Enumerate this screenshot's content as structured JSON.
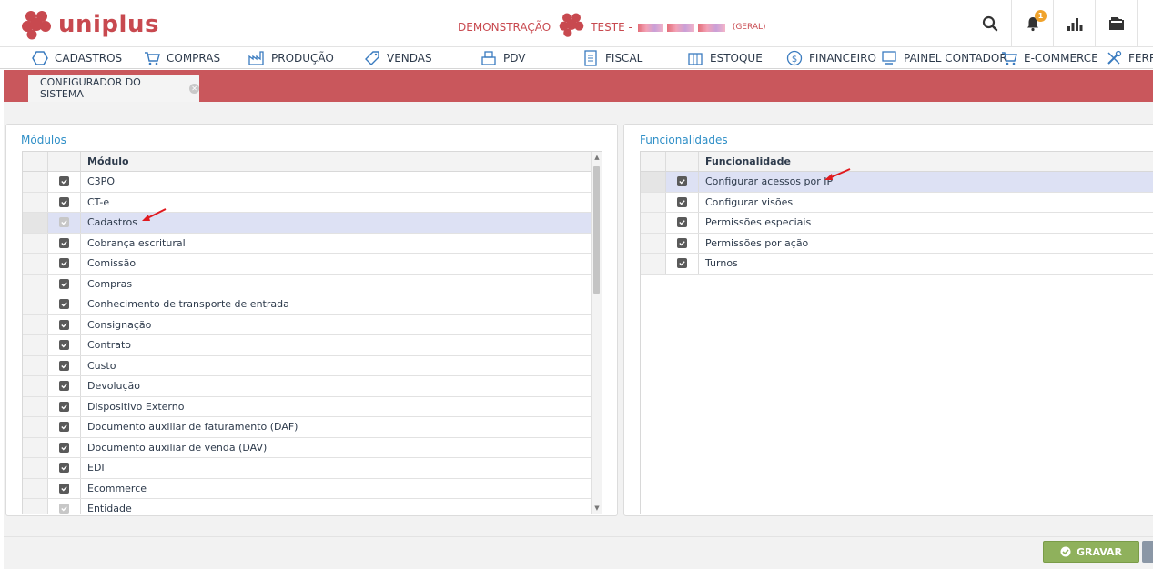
{
  "header": {
    "logo_text": "uniplus",
    "environment_label": "DEMONSTRAÇÃO",
    "company_label": "TESTE -",
    "branch_label": "(GERAL)",
    "notification_count": "1",
    "brand_color": "#c8494f"
  },
  "menu": {
    "items": [
      {
        "label": "CADASTROS",
        "icon": "hexagon-icon"
      },
      {
        "label": "COMPRAS",
        "icon": "cart-icon"
      },
      {
        "label": "PRODUÇÃO",
        "icon": "factory-icon"
      },
      {
        "label": "VENDAS",
        "icon": "tag-icon"
      },
      {
        "label": "PDV",
        "icon": "cash-register-icon"
      },
      {
        "label": "FISCAL",
        "icon": "document-icon"
      },
      {
        "label": "ESTOQUE",
        "icon": "box-icon"
      },
      {
        "label": "FINANCEIRO",
        "icon": "dollar-icon"
      },
      {
        "label": "PAINEL CONTADOR",
        "icon": "monitor-icon"
      },
      {
        "label": "E-COMMERCE",
        "icon": "cart-icon"
      },
      {
        "label": "FERRA",
        "icon": "tools-icon"
      }
    ]
  },
  "tabs": [
    {
      "label": "CONFIGURADOR DO SISTEMA",
      "active": true
    }
  ],
  "modules_panel": {
    "title": "Módulos",
    "column_header": "Módulo",
    "rows": [
      {
        "label": "C3PO",
        "checked": true,
        "disabled": false,
        "selected": false
      },
      {
        "label": "CT-e",
        "checked": true,
        "disabled": false,
        "selected": false
      },
      {
        "label": "Cadastros",
        "checked": true,
        "disabled": true,
        "selected": true
      },
      {
        "label": "Cobrança escritural",
        "checked": true,
        "disabled": false,
        "selected": false
      },
      {
        "label": "Comissão",
        "checked": true,
        "disabled": false,
        "selected": false
      },
      {
        "label": "Compras",
        "checked": true,
        "disabled": false,
        "selected": false
      },
      {
        "label": "Conhecimento de transporte de entrada",
        "checked": true,
        "disabled": false,
        "selected": false
      },
      {
        "label": "Consignação",
        "checked": true,
        "disabled": false,
        "selected": false
      },
      {
        "label": "Contrato",
        "checked": true,
        "disabled": false,
        "selected": false
      },
      {
        "label": "Custo",
        "checked": true,
        "disabled": false,
        "selected": false
      },
      {
        "label": "Devolução",
        "checked": true,
        "disabled": false,
        "selected": false
      },
      {
        "label": "Dispositivo Externo",
        "checked": true,
        "disabled": false,
        "selected": false
      },
      {
        "label": "Documento auxiliar de faturamento (DAF)",
        "checked": true,
        "disabled": false,
        "selected": false
      },
      {
        "label": "Documento auxiliar de venda (DAV)",
        "checked": true,
        "disabled": false,
        "selected": false
      },
      {
        "label": "EDI",
        "checked": true,
        "disabled": false,
        "selected": false
      },
      {
        "label": "Ecommerce",
        "checked": true,
        "disabled": false,
        "selected": false
      },
      {
        "label": "Entidade",
        "checked": true,
        "disabled": true,
        "selected": false
      }
    ]
  },
  "features_panel": {
    "title": "Funcionalidades",
    "column_header": "Funcionalidade",
    "rows": [
      {
        "label": "Configurar acessos por IP",
        "checked": true,
        "selected": true
      },
      {
        "label": "Configurar visões",
        "checked": true,
        "selected": false
      },
      {
        "label": "Permissões especiais",
        "checked": true,
        "selected": false
      },
      {
        "label": "Permissões por ação",
        "checked": true,
        "selected": false
      },
      {
        "label": "Turnos",
        "checked": true,
        "selected": false
      }
    ]
  },
  "footer": {
    "save_label": "GRAVAR"
  }
}
